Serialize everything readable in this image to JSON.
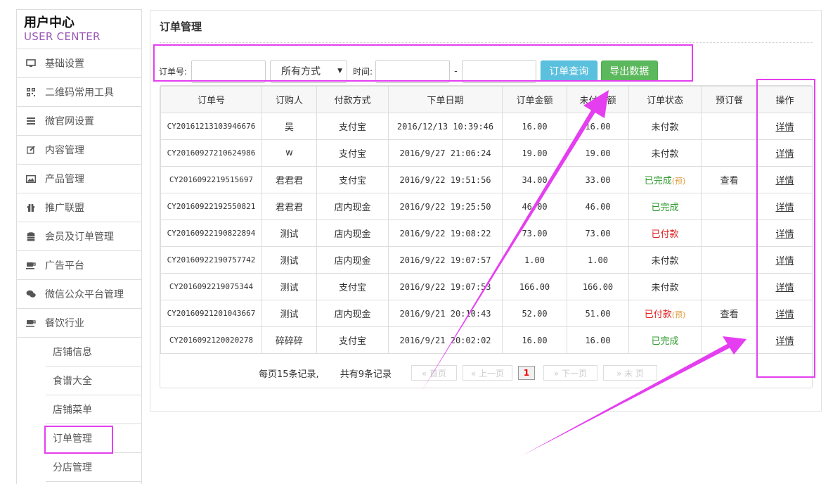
{
  "sidebar": {
    "title_cn": "用户中心",
    "title_en": "USER CENTER",
    "items": [
      {
        "label": "基础设置",
        "icon": "monitor-icon"
      },
      {
        "label": "二维码常用工具",
        "icon": "qrcode-icon"
      },
      {
        "label": "微官网设置",
        "icon": "menu-lines-icon"
      },
      {
        "label": "内容管理",
        "icon": "edit-icon"
      },
      {
        "label": "产品管理",
        "icon": "image-icon"
      },
      {
        "label": "推广联盟",
        "icon": "gift-icon"
      },
      {
        "label": "会员及订单管理",
        "icon": "database-icon"
      },
      {
        "label": "广告平台",
        "icon": "cup-icon"
      },
      {
        "label": "微信公众平台管理",
        "icon": "chat-icon"
      },
      {
        "label": "餐饮行业",
        "icon": "cup-icon"
      }
    ],
    "sub_items": [
      "店铺信息",
      "食谱大全",
      "店铺菜单",
      "订单管理",
      "分店管理"
    ]
  },
  "panel": {
    "title": "订单管理",
    "search": {
      "order_no_label": "订单号:",
      "pay_method_selected": "所有方式",
      "time_label": "时间:",
      "range_sep": "-",
      "query_button": "订单查询",
      "export_button": "导出数据"
    },
    "table": {
      "headers": [
        "订单号",
        "订购人",
        "付款方式",
        "下单日期",
        "订单金额",
        "未付金额",
        "订单状态",
        "预订餐",
        "操作"
      ],
      "rows": [
        {
          "id": "CY20161213103946676",
          "buyer": "吴",
          "pay": "支付宝",
          "date": "2016/12/13 10:39:46",
          "amount": "16.00",
          "unpaid": "16.00",
          "status": "未付款",
          "pre": "",
          "view": "",
          "action": "详情"
        },
        {
          "id": "CY20160927210624986",
          "buyer": "w",
          "pay": "支付宝",
          "date": "2016/9/27 21:06:24",
          "amount": "19.00",
          "unpaid": "19.00",
          "status": "未付款",
          "pre": "",
          "view": "",
          "action": "详情"
        },
        {
          "id": "CY2016092219515697",
          "buyer": "君君君",
          "pay": "支付宝",
          "date": "2016/9/22 19:51:56",
          "amount": "34.00",
          "unpaid": "33.00",
          "status": "已完成",
          "pre": "(预)",
          "view": "查看",
          "action": "详情"
        },
        {
          "id": "CY20160922192550821",
          "buyer": "君君君",
          "pay": "店内现金",
          "date": "2016/9/22 19:25:50",
          "amount": "46.00",
          "unpaid": "46.00",
          "status": "已完成",
          "pre": "",
          "view": "",
          "action": "详情"
        },
        {
          "id": "CY20160922190822894",
          "buyer": "测试",
          "pay": "店内现金",
          "date": "2016/9/22 19:08:22",
          "amount": "73.00",
          "unpaid": "73.00",
          "status": "已付款",
          "pre": "",
          "view": "",
          "action": "详情"
        },
        {
          "id": "CY20160922190757742",
          "buyer": "测试",
          "pay": "店内现金",
          "date": "2016/9/22 19:07:57",
          "amount": "1.00",
          "unpaid": "1.00",
          "status": "未付款",
          "pre": "",
          "view": "",
          "action": "详情"
        },
        {
          "id": "CY2016092219075344",
          "buyer": "测试",
          "pay": "支付宝",
          "date": "2016/9/22 19:07:53",
          "amount": "166.00",
          "unpaid": "166.00",
          "status": "未付款",
          "pre": "",
          "view": "",
          "action": "详情"
        },
        {
          "id": "CY20160921201043667",
          "buyer": "测试",
          "pay": "店内现金",
          "date": "2016/9/21 20:10:43",
          "amount": "52.00",
          "unpaid": "51.00",
          "status": "已付款",
          "pre": "(预)",
          "view": "查看",
          "action": "详情"
        },
        {
          "id": "CY2016092120020278",
          "buyer": "碎碎碎",
          "pay": "支付宝",
          "date": "2016/9/21 20:02:02",
          "amount": "16.00",
          "unpaid": "16.00",
          "status": "已完成",
          "pre": "",
          "view": "",
          "action": "详情"
        }
      ]
    },
    "pager": {
      "per_page": "每页15条记录,",
      "total": "共有9条记录",
      "first": "« 首页",
      "prev": "« 上一页",
      "current": "1",
      "next": "» 下一页",
      "last": "» 末 页"
    }
  },
  "colors": {
    "annotation": "#e53ef0",
    "done": "#2d9a2d",
    "paid": "#e02020"
  }
}
